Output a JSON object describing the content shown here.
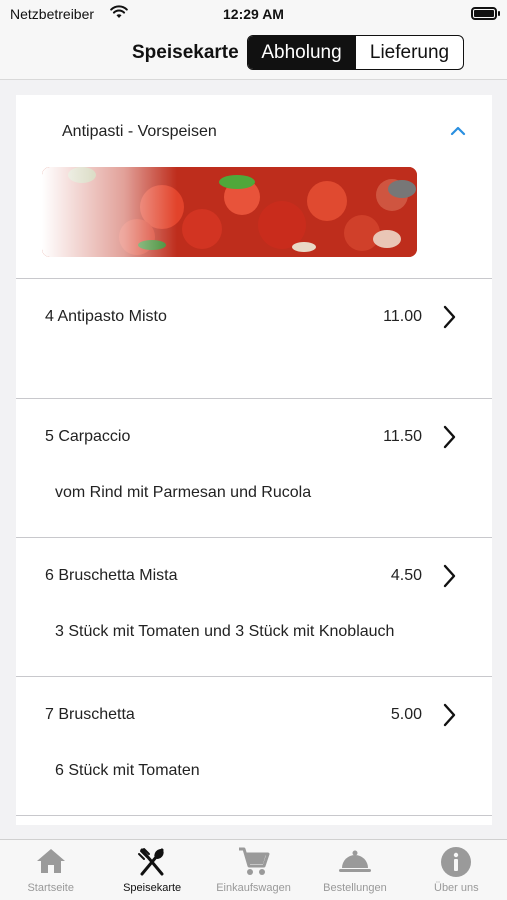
{
  "status_bar": {
    "carrier": "Netzbetreiber",
    "time": "12:29 AM"
  },
  "nav": {
    "title": "Speisekarte",
    "segments": [
      {
        "label": "Abholung",
        "active": true
      },
      {
        "label": "Lieferung",
        "active": false
      }
    ]
  },
  "section": {
    "title": "Antipasti - Vorspeisen",
    "accent_color": "#2a8fe0"
  },
  "items": [
    {
      "name": "4 Antipasto Misto",
      "price": "11.00",
      "description": ""
    },
    {
      "name": "5 Carpaccio",
      "price": "11.50",
      "description": "vom Rind mit Parmesan und Rucola"
    },
    {
      "name": "6 Bruschetta Mista",
      "price": "4.50",
      "description": "3 Stück mit Tomaten und 3 Stück mit Knoblauch"
    },
    {
      "name": "7 Bruschetta",
      "price": "5.00",
      "description": "6 Stück mit Tomaten"
    }
  ],
  "tabs": [
    {
      "label": "Startseite",
      "icon": "home-icon",
      "active": false
    },
    {
      "label": "Speisekarte",
      "icon": "fork-knife-icon",
      "active": true
    },
    {
      "label": "Einkaufswagen",
      "icon": "cart-icon",
      "active": false
    },
    {
      "label": "Bestellungen",
      "icon": "cloche-icon",
      "active": false
    },
    {
      "label": "Über uns",
      "icon": "info-icon",
      "active": false
    }
  ]
}
